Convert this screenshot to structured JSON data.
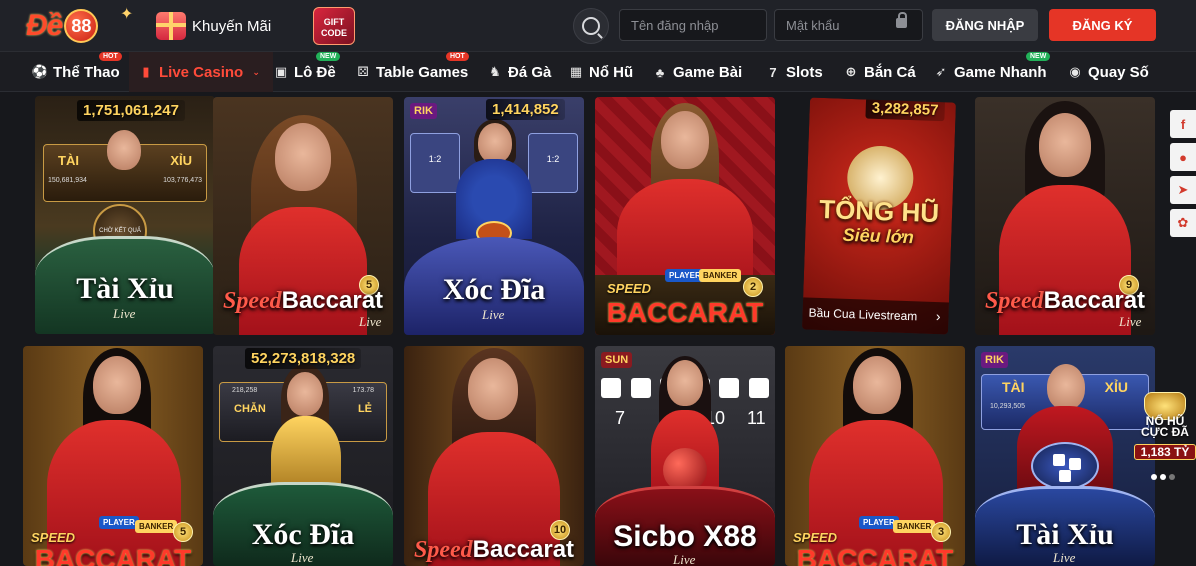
{
  "header": {
    "logo_text": "Đề 88",
    "promo_label": "Khuyến Mãi",
    "giftcode_label": "GIFT CODE",
    "username_placeholder": "Tên đăng nhập",
    "password_placeholder": "Mật khẩu",
    "login_label": "ĐĂNG NHẬP",
    "register_label": "ĐĂNG KÝ"
  },
  "nav": {
    "items": [
      {
        "label": "Thể Thao",
        "icon": "soccer-ball-icon",
        "tag": "HOT"
      },
      {
        "label": "Live Casino",
        "icon": "cards-icon",
        "tag": ""
      },
      {
        "label": "Lô Đề",
        "icon": "lottery-88-icon",
        "tag": "NEW"
      },
      {
        "label": "Table Games",
        "icon": "dice-icon",
        "tag": "HOT"
      },
      {
        "label": "Đá Gà",
        "icon": "rooster-icon",
        "tag": ""
      },
      {
        "label": "Nổ Hũ",
        "icon": "slot-machine-icon",
        "tag": ""
      },
      {
        "label": "Game Bài",
        "icon": "club-card-icon",
        "tag": ""
      },
      {
        "label": "Slots",
        "icon": "seven-icon",
        "tag": ""
      },
      {
        "label": "Bắn Cá",
        "icon": "crosshair-icon",
        "tag": ""
      },
      {
        "label": "Game Nhanh",
        "icon": "rocket-icon",
        "tag": "NEW"
      },
      {
        "label": "Quay Số",
        "icon": "lottery-ball-icon",
        "tag": ""
      }
    ]
  },
  "games": [
    {
      "title": "Tài Xỉu",
      "subtitle": "Live",
      "jackpot": "1,751,061,247",
      "badge": "",
      "brand": "",
      "inner_left": "TÀI",
      "inner_right": "XỈU",
      "inner_left_value": "150,681,934",
      "inner_right_value": "103,776,473",
      "center": "CHỜ KẾT QUẢ"
    },
    {
      "title": "Baccarat",
      "title_prefix": "Speed",
      "subtitle": "Live",
      "badge": "5"
    },
    {
      "title": "Xóc Đĩa",
      "subtitle": "Live",
      "jackpot": "1,414,852",
      "brand": "RIK",
      "inner_left": "1:2",
      "inner_right": "1:2"
    },
    {
      "title": "BACCARAT",
      "title_prefix": "SPEED",
      "badge": "2",
      "player": "PLAYER",
      "banker": "BANKER"
    },
    {
      "title": "TỔNG HŨ",
      "subtitle": "Siêu lớn",
      "jackpot": "3,282,857",
      "caption": "Bầu Cua Livestream"
    },
    {
      "title": "Baccarat",
      "title_prefix": "Speed",
      "subtitle": "Live",
      "badge": "9"
    },
    {
      "title": "BACCARAT",
      "title_prefix": "SPEED",
      "badge": "5",
      "player": "PLAYER",
      "banker": "BANKER"
    },
    {
      "title": "Xóc Đĩa",
      "subtitle": "Live",
      "jackpot": "52,273,818,328",
      "inner_left": "CHẴN",
      "inner_right": "LẺ",
      "inner_left_value": "218,258",
      "inner_right_value": "173.78"
    },
    {
      "title": "Baccarat",
      "title_prefix": "Speed",
      "subtitle": "Live",
      "badge": "10"
    },
    {
      "title": "Sicbo X88",
      "subtitle": "Live",
      "brand": "SUN",
      "numbers": [
        "7",
        "10",
        "11"
      ]
    },
    {
      "title": "BACCARAT",
      "title_prefix": "SPEED",
      "badge": "3",
      "player": "PLAYER",
      "banker": "BANKER"
    },
    {
      "title": "Tài Xỉu",
      "subtitle": "Live",
      "brand": "RIK",
      "inner_left": "TÀI",
      "inner_right": "XỈU",
      "inner_left_value": "10,293,505"
    }
  ],
  "floating": {
    "nohu_line1": "NỔ HŨ",
    "nohu_line2": "CỰC ĐÃ",
    "nohu_amount": "1,183 TỶ"
  },
  "colors": {
    "accent": "#e53526",
    "active_nav": "#ff4b3a",
    "gold": "#ffd460"
  }
}
